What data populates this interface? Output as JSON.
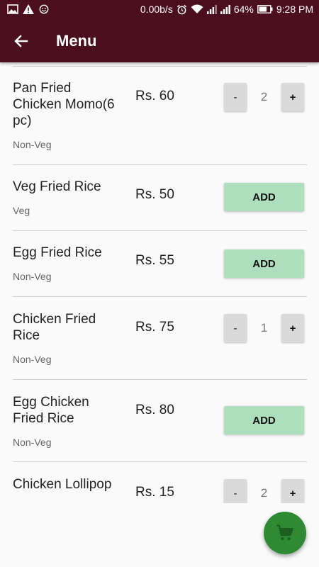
{
  "status_bar": {
    "icons_left": [
      "image-icon",
      "warning-icon",
      "smiley-icon"
    ],
    "network_speed": "0.00b/s",
    "battery": "64%",
    "time": "9:28 PM",
    "icons_right": [
      "alarm-icon",
      "wifi-icon",
      "signal-icon",
      "signal-icon",
      "battery-icon"
    ]
  },
  "app_bar": {
    "title": "Menu",
    "back_icon": "arrow-back-icon",
    "color": "#4a0e1c"
  },
  "menu_items": [
    {
      "name": "Pan Fried Chicken Momo(6 pc)",
      "category": "Non-Veg",
      "price": "Rs. 60",
      "action": "quantity",
      "quantity": "2",
      "minus": "-",
      "plus": "+"
    },
    {
      "name": "Veg Fried Rice",
      "category": "Veg",
      "price": "Rs. 50",
      "action": "add",
      "add_label": "ADD"
    },
    {
      "name": "Egg Fried Rice",
      "category": "Non-Veg",
      "price": "Rs. 55",
      "action": "add",
      "add_label": "ADD"
    },
    {
      "name": "Chicken Fried Rice",
      "category": "Non-Veg",
      "price": "Rs. 75",
      "action": "quantity",
      "quantity": "1",
      "minus": "-",
      "plus": "+"
    },
    {
      "name": "Egg Chicken Fried Rice",
      "category": "Non-Veg",
      "price": "Rs. 80",
      "action": "add",
      "add_label": "ADD"
    },
    {
      "name": "Chicken Lollipop",
      "category": "",
      "price": "Rs. 15",
      "action": "quantity",
      "quantity": "2",
      "minus": "-",
      "plus": "+"
    }
  ],
  "fab": {
    "icon": "cart-icon",
    "color": "#2e8b34"
  },
  "colors": {
    "add_button": "#aedfbd",
    "qty_button": "#dadada"
  }
}
